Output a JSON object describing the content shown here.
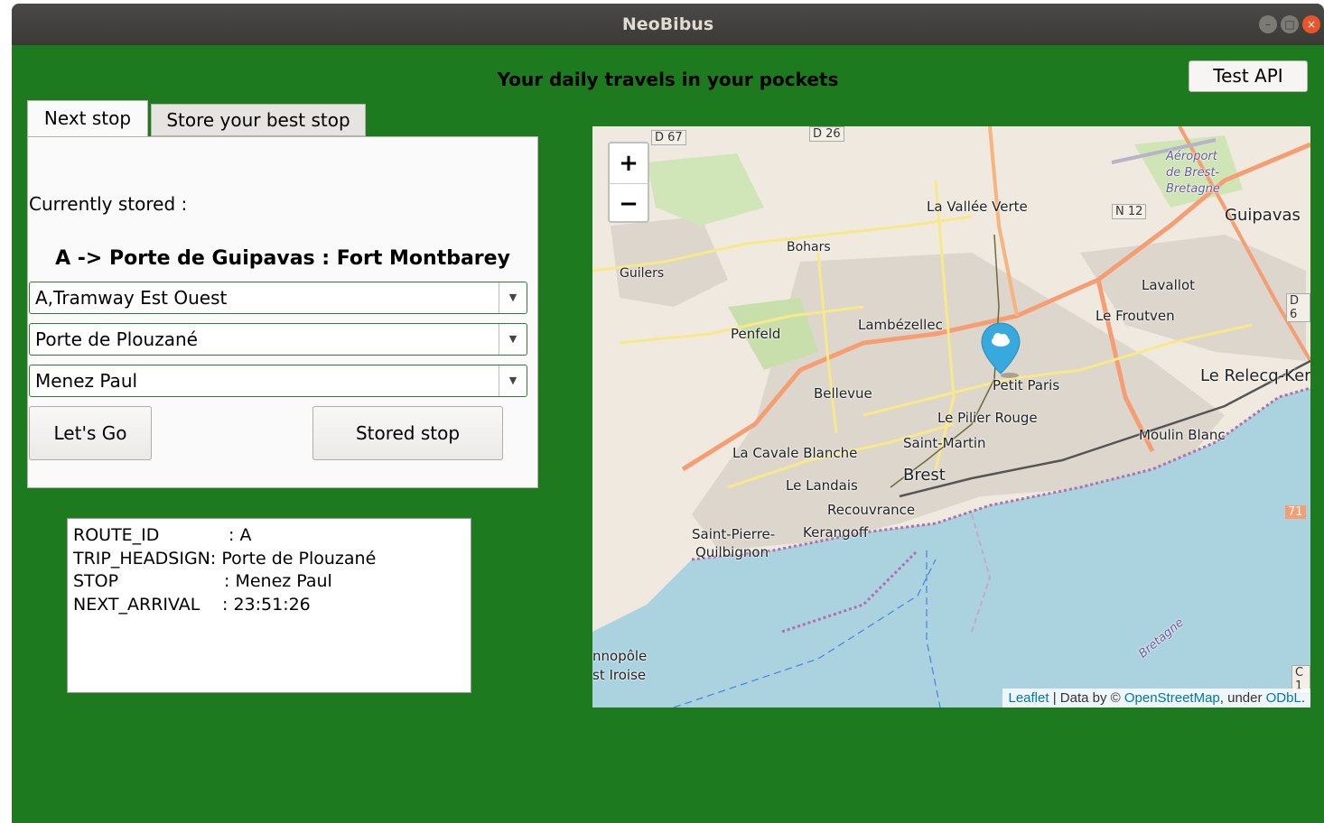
{
  "window": {
    "title": "NeoBibus",
    "controls": {
      "minimize": "–",
      "maximize": "□",
      "close": "×"
    }
  },
  "header": {
    "tagline": "Your daily travels in your pockets",
    "test_api_label": "Test API"
  },
  "tabs": [
    {
      "label": "Next stop",
      "active": true
    },
    {
      "label": "Store your best stop",
      "active": false
    }
  ],
  "next_stop": {
    "currently_stored_label": "Currently stored :",
    "stored_summary": "A -> Porte de Guipavas : Fort Montbarey",
    "line_select": "A,Tramway Est Ouest",
    "direction_select": "Porte de Plouzané",
    "stop_select": "Menez Paul",
    "lets_go_label": "Let's Go",
    "stored_stop_label": "Stored stop"
  },
  "info": {
    "route_id_key": "ROUTE_ID",
    "route_id_value": ": A",
    "trip_headsign_key": "TRIP_HEADSIGN",
    "trip_headsign_value": ": Porte de Plouzané",
    "stop_key": "STOP",
    "stop_value": ": Menez Paul",
    "next_arrival_key": "NEXT_ARRIVAL",
    "next_arrival_value": ": 23:51:26"
  },
  "map": {
    "zoom_in": "+",
    "zoom_out": "−",
    "attribution": {
      "leaflet": "Leaflet",
      "data_by": " | Data by © ",
      "osm": "OpenStreetMap",
      "under": ", under ",
      "odbl": "ODbL",
      "period": "."
    },
    "labels": {
      "d67": "D 67",
      "d26": "D 26",
      "n12": "N 12",
      "d6": "D 6",
      "c1": "C 1",
      "r71": "71",
      "aeroport": "Aéroport",
      "de_brest": "de Brest-",
      "bretagne_airport": "Bretagne",
      "la_vallee_verte": "La Vallée Verte",
      "guipavas": "Guipavas",
      "bohars": "Bohars",
      "guilers": "Guilers",
      "lavallot": "Lavallot",
      "le_froutven": "Le Froutven",
      "penfeld": "Penfeld",
      "lambezellec": "Lambézellec",
      "le_relecq": "Le Relecq-Ker",
      "bellevue": "Bellevue",
      "petit_paris": "Petit Paris",
      "le_pilier_rouge": "Le Pilier Rouge",
      "moulin_blanc": "Moulin Blanc",
      "la_cavale_blanche": "La Cavale Blanche",
      "saint_martin": "Saint-Martin",
      "brest": "Brest",
      "le_landais": "Le Landais",
      "recouvrance": "Recouvrance",
      "saint_pierre": "Saint-Pierre-",
      "quilbignon": "Quilbignon",
      "kerangoff": "Kerangoff",
      "technopole": "nnopôle",
      "iroise": "st Iroise",
      "bretagne_coast": "Bretagne"
    },
    "colors": {
      "sea": "#aad3df",
      "land": "#efe9df",
      "urban": "#dcd6cd",
      "marker": "#38a9dc"
    }
  }
}
